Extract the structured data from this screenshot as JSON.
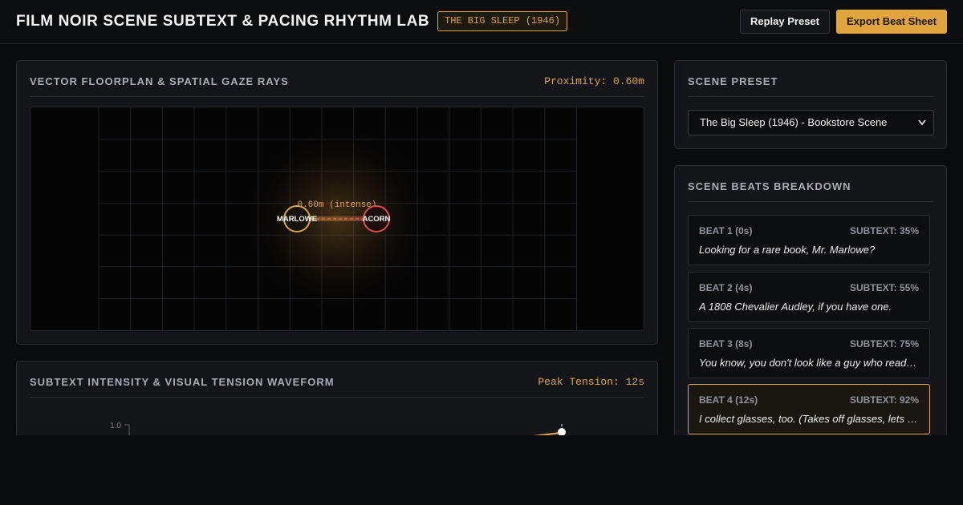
{
  "header": {
    "title": "FILM NOIR SCENE SUBTEXT & PACING RHYTHM LAB",
    "film_badge": "THE BIG SLEEP (1946)",
    "replay_label": "Replay Preset",
    "export_label": "Export Beat Sheet"
  },
  "floorplan": {
    "title": "VECTOR FLOORPLAN & SPATIAL GAZE RAYS",
    "proximity": "Proximity: 0.60m",
    "characters": [
      {
        "name": "MARLOWE",
        "color": "#e0a53d"
      },
      {
        "name": "ACORN",
        "color": "#e04a4a"
      }
    ],
    "distance_label": "0.60m (intense)"
  },
  "waveform": {
    "title": "SUBTEXT INTENSITY & VISUAL TENSION WAVEFORM",
    "peak": "Peak Tension: 12s",
    "y_tick": "1.0"
  },
  "preset": {
    "title": "SCENE PRESET",
    "selected": "The Big Sleep (1946) - Bookstore Scene"
  },
  "beats": {
    "title": "SCENE BEATS BREAKDOWN",
    "items": [
      {
        "label": "BEAT 1 (0s)",
        "subtext": "SUBTEXT: 35%",
        "line": "Looking for a rare book, Mr. Marlowe?"
      },
      {
        "label": "BEAT 2 (4s)",
        "subtext": "SUBTEXT: 55%",
        "line": "A 1808 Chevalier Audley, if you have one."
      },
      {
        "label": "BEAT 3 (8s)",
        "subtext": "SUBTEXT: 75%",
        "line": "You know, you don't look like a guy who reads books."
      },
      {
        "label": "BEAT 4 (12s)",
        "subtext": "SUBTEXT: 92%",
        "line": "I collect glasses, too. (Takes off glasses, lets down hair)",
        "active": true
      }
    ]
  },
  "colors": {
    "accent": "#e0a53d",
    "danger": "#e04a4a",
    "background": "#0a0b0d",
    "panel": "#141518"
  }
}
